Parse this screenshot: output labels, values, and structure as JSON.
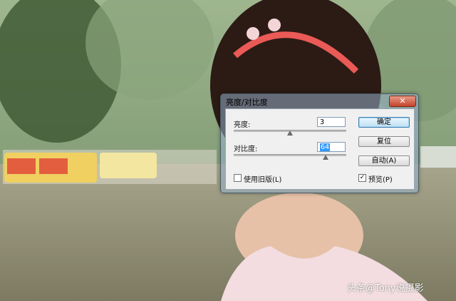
{
  "dialog": {
    "title": "亮度/对比度",
    "close_glyph": "✕",
    "brightness_label": "亮度:",
    "brightness_value": "3",
    "contrast_label": "对比度:",
    "contrast_value": "64",
    "legacy_label": "使用旧版(L)",
    "legacy_checked": false,
    "preview_label": "预览(P)",
    "preview_checked": true,
    "ok_label": "确定",
    "reset_label": "复位",
    "auto_label": "自动(A)"
  },
  "watermark": "头条@Tony说摄影"
}
